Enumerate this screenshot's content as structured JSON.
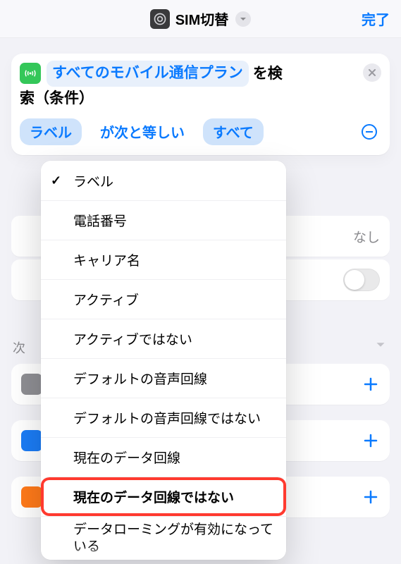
{
  "nav": {
    "title": "SIM切替",
    "done": "完了"
  },
  "card": {
    "prefix_token": "すべてのモバイル通信プラン",
    "after_token": "を検",
    "line2": "索（条件）"
  },
  "filter": {
    "field": "ラベル",
    "op": "が次と等しい",
    "value": "すべて"
  },
  "peek": {
    "none": "なし",
    "next": "次"
  },
  "dropdown": [
    "ラベル",
    "電話番号",
    "キャリア名",
    "アクティブ",
    "アクティブではない",
    "デフォルトの音声回線",
    "デフォルトの音声回線ではない",
    "現在のデータ回線",
    "現在のデータ回線ではない",
    "データローミングが有効になっている"
  ]
}
